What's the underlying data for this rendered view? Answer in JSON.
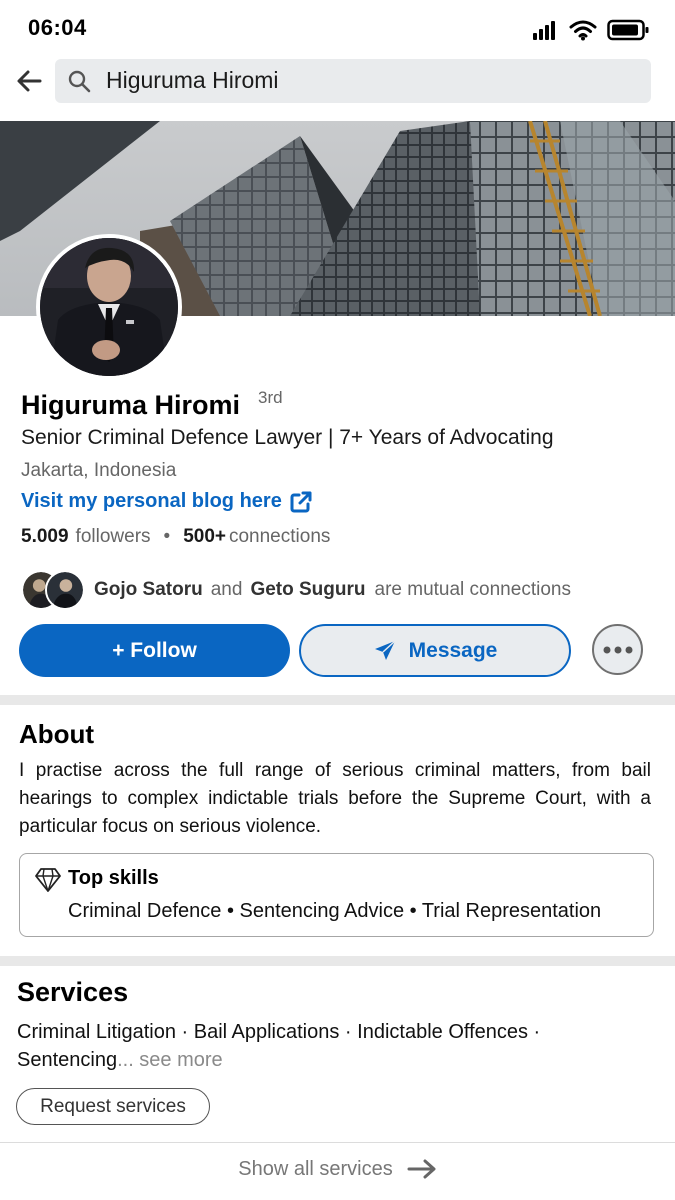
{
  "status_bar": {
    "time": "06:04",
    "icons": [
      "signal-icon",
      "wifi-icon",
      "battery-icon"
    ]
  },
  "search": {
    "query": "Higuruma Hiromi"
  },
  "profile": {
    "name": "Higuruma Hiromi",
    "degree": "3rd",
    "headline": "Senior Criminal Defence Lawyer | 7+ Years of Advocating",
    "location": "Jakarta, Indonesia",
    "blog_link": "Visit my personal blog here",
    "followers_count": "5.009",
    "followers_label": "followers",
    "connections_count": "500+",
    "connections_label": "connections",
    "mutual_1": "Gojo Satoru",
    "mutual_and": "and",
    "mutual_2": "Geto Suguru",
    "mutual_suffix": "are mutual connections"
  },
  "actions": {
    "follow": "+ Follow",
    "message": "Message"
  },
  "about": {
    "title": "About",
    "text": "I practise across the full range of serious criminal matters, from bail hearings to complex indictable trials before the Supreme Court, with a particular focus on serious violence.",
    "skills_title": "Top skills",
    "skills": "Criminal Defence • Sentencing Advice • Trial Representation"
  },
  "services": {
    "title": "Services",
    "text": "Criminal Litigation · Bail Applications · Indictable Offences · Sentencing",
    "see_more": "... see more",
    "request": "Request services",
    "show_all": "Show all services"
  },
  "colors": {
    "accent": "#0a66c2",
    "divider": "#e8e8e8"
  }
}
